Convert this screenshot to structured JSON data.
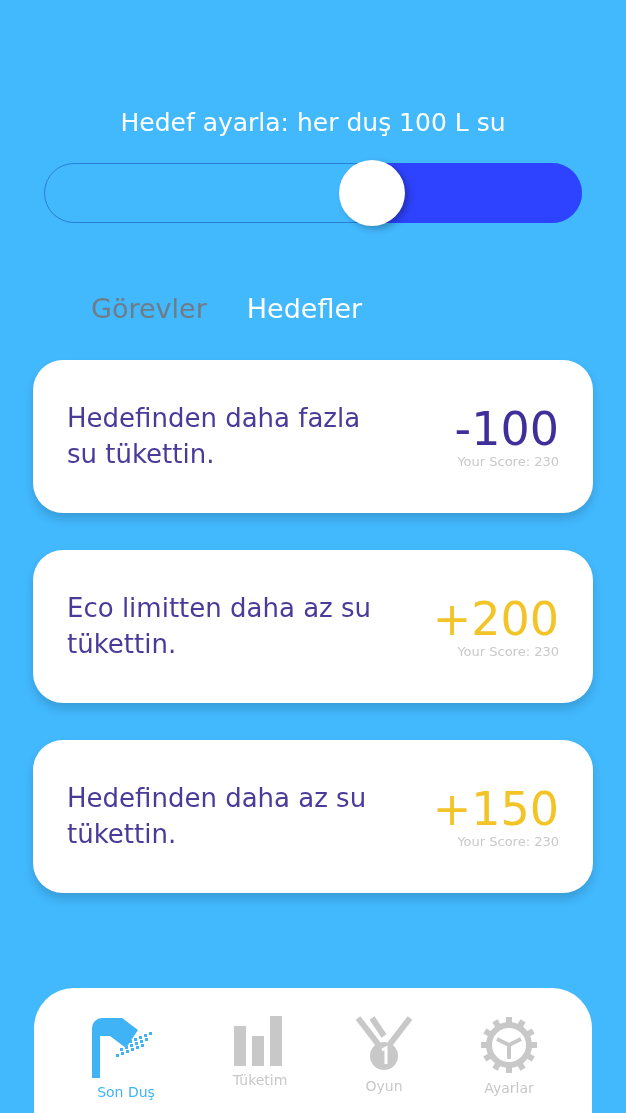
{
  "goal": {
    "title": "Hedef ayarla: her duş 100 L su",
    "level": 0.61
  },
  "tabs": [
    {
      "label": "Görevler",
      "selected": false
    },
    {
      "label": "Hedefler",
      "selected": true
    }
  ],
  "cards": [
    {
      "text": "Hedefinden daha fazla su tükettin.",
      "points": "-100",
      "kind": "penalty",
      "score": "Your Score: 230"
    },
    {
      "text": "Eco limitten daha az su tükettin.",
      "points": "+200",
      "kind": "reward",
      "score": "Your Score: 230"
    },
    {
      "text": "Hedefinden daha az su tükettin.",
      "points": "+150",
      "kind": "reward",
      "score": "Your Score: 230"
    }
  ],
  "nav": [
    {
      "label": "Son Duş",
      "kind": "shower",
      "selected": true
    },
    {
      "label": "Tüketim",
      "kind": "bars",
      "selected": false
    },
    {
      "label": "Oyun",
      "kind": "medal",
      "selected": false
    },
    {
      "label": "Ayarlar",
      "kind": "gear",
      "selected": false
    }
  ]
}
